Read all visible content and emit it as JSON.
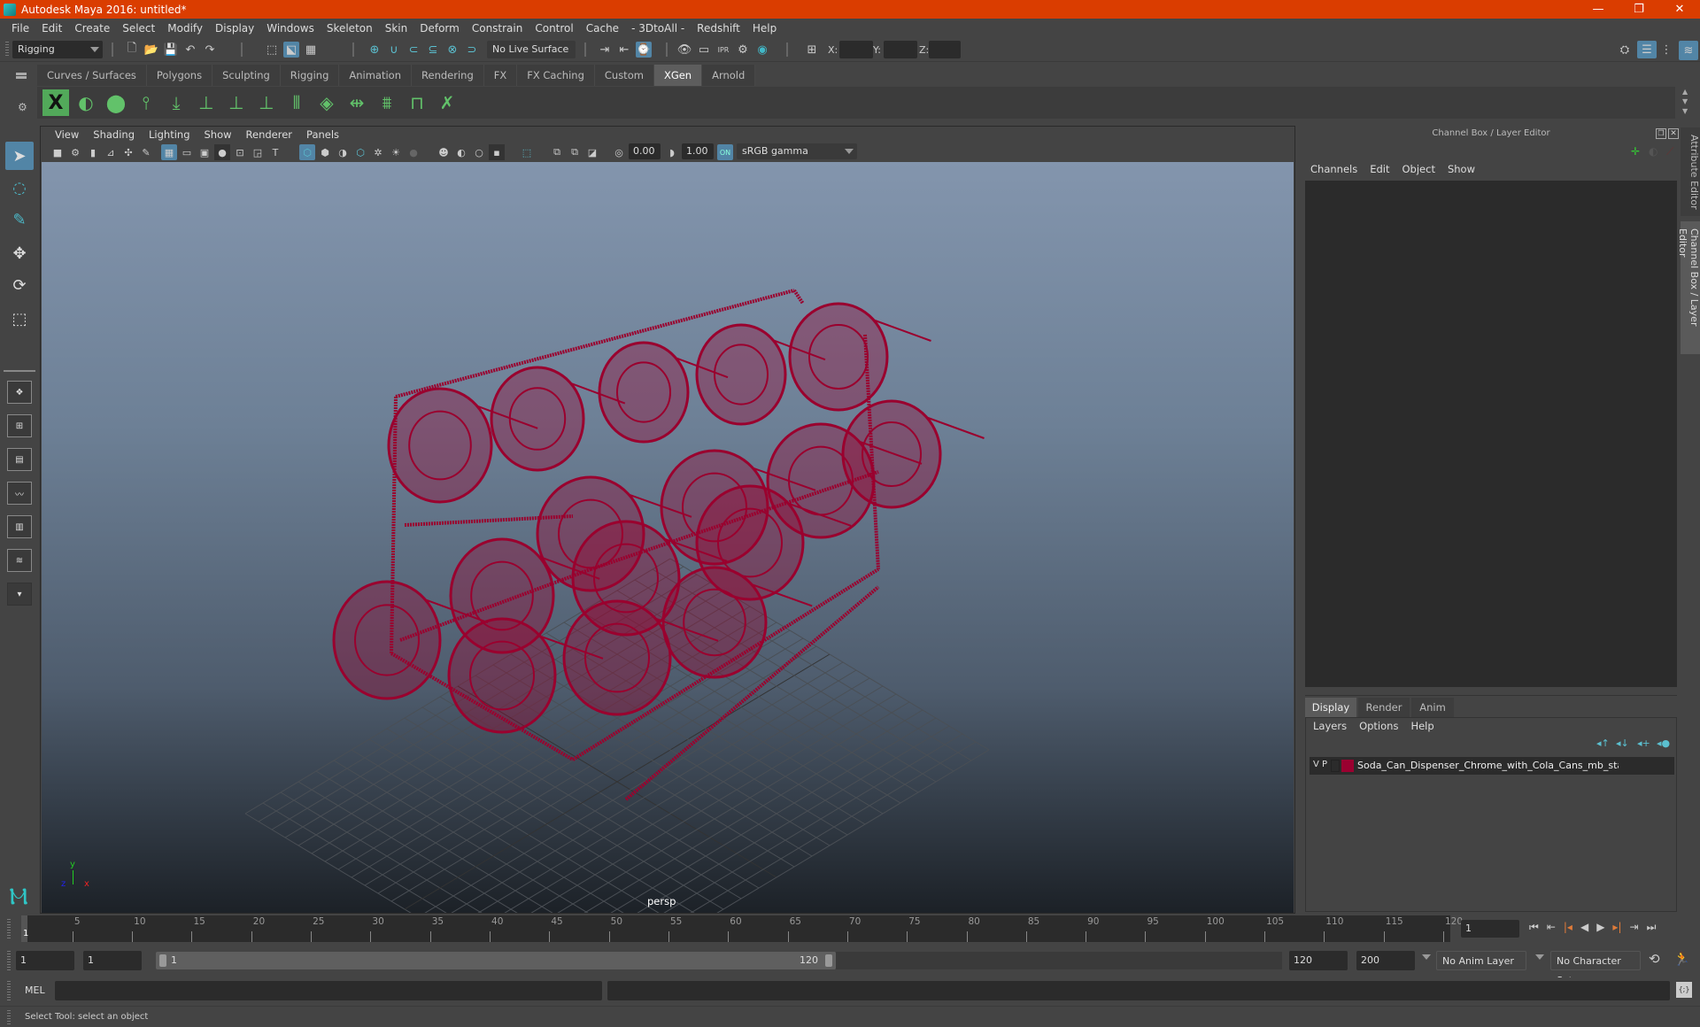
{
  "window": {
    "title": "Autodesk Maya 2016: untitled*",
    "controls": {
      "minimize": "—",
      "restore": "❐",
      "close": "✕"
    }
  },
  "menubar": [
    "File",
    "Edit",
    "Create",
    "Select",
    "Modify",
    "Display",
    "Windows",
    "Skeleton",
    "Skin",
    "Deform",
    "Constrain",
    "Control",
    "Cache",
    "- 3DtoAll -",
    "Redshift",
    "Help"
  ],
  "statusline": {
    "menuset": "Rigging",
    "live_surface": "No Live Surface",
    "x_label": "X:",
    "y_label": "Y:",
    "z_label": "Z:",
    "x_value": "",
    "y_value": "",
    "z_value": ""
  },
  "shelf": {
    "tabs": [
      "Curves / Surfaces",
      "Polygons",
      "Sculpting",
      "Rigging",
      "Animation",
      "Rendering",
      "FX",
      "FX Caching",
      "Custom",
      "XGen",
      "Arnold"
    ],
    "selected_tab": "XGen",
    "icons": [
      "xgen-library-icon",
      "xgen-preview-icon",
      "xgen-clear-icon",
      "xgen-add-guides-icon",
      "xgen-place-icon",
      "xgen-add-guide-icon",
      "xgen-guide-visibility-icon",
      "xgen-lock-guide-icon",
      "xgen-sculpt-icon",
      "xgen-density-icon",
      "xgen-bend-icon",
      "xgen-select-guide-icon",
      "xgen-guide-box-icon",
      "xgen-delete-guide-icon"
    ]
  },
  "viewport": {
    "menus": [
      "View",
      "Shading",
      "Lighting",
      "Show",
      "Renderer",
      "Panels"
    ],
    "exposure": "0.00",
    "gamma": "1.00",
    "color_space": "sRGB gamma",
    "camera_label": "persp",
    "axis": {
      "x": "x",
      "y": "y",
      "z": "z"
    },
    "wireframe_color": "#9a002e"
  },
  "channel_box": {
    "title": "Channel Box / Layer Editor",
    "menus": [
      "Channels",
      "Edit",
      "Object",
      "Show"
    ]
  },
  "layer_editor": {
    "tabs": [
      "Display",
      "Render",
      "Anim"
    ],
    "selected_tab": "Display",
    "menus": [
      "Layers",
      "Options",
      "Help"
    ],
    "layers": [
      {
        "visible": "V",
        "playback": "P",
        "color": "#9a0030",
        "name": "Soda_Can_Dispenser_Chrome_with_Cola_Cans_mb_stanc"
      }
    ]
  },
  "side_tabs": [
    "Attribute Editor",
    "Channel Box / Layer Editor"
  ],
  "timeline": {
    "start": 1,
    "end": 120,
    "current_frame": "1",
    "ticks": [
      5,
      10,
      15,
      20,
      25,
      30,
      35,
      40,
      45,
      50,
      55,
      60,
      65,
      70,
      75,
      80,
      85,
      90,
      95,
      100,
      105,
      110,
      115,
      120
    ],
    "current_frame_field": "1"
  },
  "range": {
    "start_time": "1",
    "playback_start": "1",
    "slider_start": "1",
    "slider_end": "120",
    "playback_end": "120",
    "end_time": "200",
    "anim_layer": "No Anim Layer",
    "character_set": "No Character Set"
  },
  "command_line": {
    "language": "MEL",
    "input": "",
    "output": ""
  },
  "help_line": "Select Tool: select an object"
}
